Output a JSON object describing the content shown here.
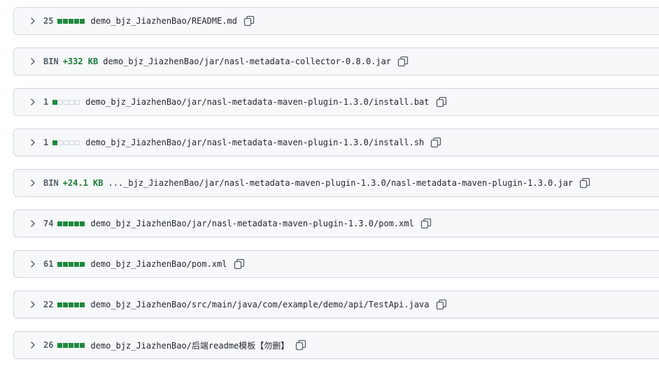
{
  "files": [
    {
      "kind": "count",
      "value": "25",
      "diffstat": [
        "add",
        "add",
        "add",
        "add",
        "add"
      ],
      "path": "demo_bjz_JiazhenBao/README.md"
    },
    {
      "kind": "binary",
      "value": "BIN",
      "size": "+332 KB",
      "diffstat": [],
      "path": "demo_bjz_JiazhenBao/jar/nasl-metadata-collector-0.8.0.jar"
    },
    {
      "kind": "count",
      "value": "1",
      "diffstat": [
        "add",
        "neutral",
        "neutral",
        "neutral",
        "neutral"
      ],
      "path": "demo_bjz_JiazhenBao/jar/nasl-metadata-maven-plugin-1.3.0/install.bat"
    },
    {
      "kind": "count",
      "value": "1",
      "diffstat": [
        "add",
        "neutral",
        "neutral",
        "neutral",
        "neutral"
      ],
      "path": "demo_bjz_JiazhenBao/jar/nasl-metadata-maven-plugin-1.3.0/install.sh"
    },
    {
      "kind": "binary",
      "value": "BIN",
      "size": "+24.1 KB",
      "diffstat": [],
      "path": "..._bjz_JiazhenBao/jar/nasl-metadata-maven-plugin-1.3.0/nasl-metadata-maven-plugin-1.3.0.jar"
    },
    {
      "kind": "count",
      "value": "74",
      "diffstat": [
        "add",
        "add",
        "add",
        "add",
        "add"
      ],
      "path": "demo_bjz_JiazhenBao/jar/nasl-metadata-maven-plugin-1.3.0/pom.xml"
    },
    {
      "kind": "count",
      "value": "61",
      "diffstat": [
        "add",
        "add",
        "add",
        "add",
        "add"
      ],
      "path": "demo_bjz_JiazhenBao/pom.xml"
    },
    {
      "kind": "count",
      "value": "22",
      "diffstat": [
        "add",
        "add",
        "add",
        "add",
        "add"
      ],
      "path": "demo_bjz_JiazhenBao/src/main/java/com/example/demo/api/TestApi.java"
    },
    {
      "kind": "count",
      "value": "26",
      "diffstat": [
        "add",
        "add",
        "add",
        "add",
        "add"
      ],
      "path": "demo_bjz_JiazhenBao/后端readme模板【勿删】"
    }
  ],
  "icons": {
    "expand": "chevron-right-icon",
    "copy": "copy-icon"
  },
  "colors": {
    "addition": "#1f883d",
    "binary_size": "#1a7f37",
    "row_background": "#f6f8fa",
    "border": "#d0d7de"
  }
}
